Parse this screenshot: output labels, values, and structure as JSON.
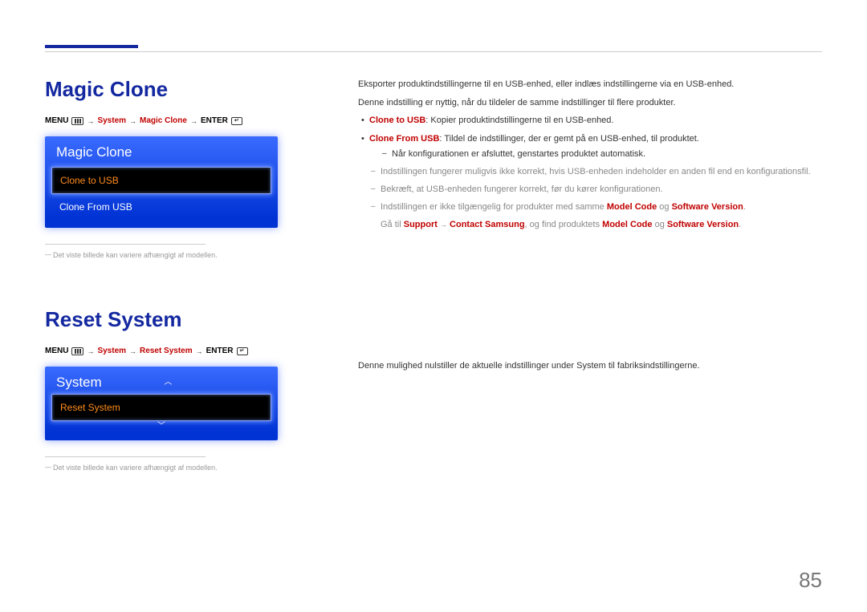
{
  "page_number": "85",
  "section1": {
    "title": "Magic Clone",
    "breadcrumb": {
      "menu": "MENU",
      "system": "System",
      "item": "Magic Clone",
      "enter": "ENTER"
    },
    "osd": {
      "title": "Magic Clone",
      "items": [
        {
          "label": "Clone to USB",
          "selected": true
        },
        {
          "label": "Clone From USB",
          "selected": false
        }
      ]
    },
    "disclaimer": "Det viste billede kan variere afhængigt af modellen.",
    "body": {
      "p1": "Eksporter produktindstillingerne til en USB-enhed, eller indlæs indstillingerne via en USB-enhed.",
      "p2": "Denne indstilling er nyttig, når du tildeler de samme indstillinger til flere produkter.",
      "li1_label": "Clone to USB",
      "li1_text": ": Kopier produktindstillingerne til en USB-enhed.",
      "li2_label": "Clone From USB",
      "li2_text": ": Tildel de indstillinger, der er gemt på en USB-enhed, til produktet.",
      "sub1": "Når konfigurationen er afsluttet, genstartes produktet automatisk.",
      "sub2": "Indstillingen fungerer muligvis ikke korrekt, hvis USB-enheden indeholder en anden fil end en konfigurationsfil.",
      "sub3": "Bekræft, at USB-enheden fungerer korrekt, før du kører konfigurationen.",
      "sub4_a": "Indstillingen er ikke tilgængelig for produkter med samme ",
      "sub4_mc": "Model Code",
      "sub4_b": " og ",
      "sub4_sv": "Software Version",
      "sub4_c": ".",
      "sub5_a": "Gå til ",
      "sub5_support": "Support",
      "sub5_b": " ",
      "sub5_contact": "Contact Samsung",
      "sub5_c": ", og find produktets ",
      "sub5_mc": "Model Code",
      "sub5_d": " og ",
      "sub5_sv": "Software Version",
      "sub5_e": "."
    }
  },
  "section2": {
    "title": "Reset System",
    "breadcrumb": {
      "menu": "MENU",
      "system": "System",
      "item": "Reset System",
      "enter": "ENTER"
    },
    "osd": {
      "title": "System",
      "items": [
        {
          "label": "Reset System",
          "selected": true
        }
      ]
    },
    "disclaimer": "Det viste billede kan variere afhængigt af modellen.",
    "body": {
      "p1": "Denne mulighed nulstiller de aktuelle indstillinger under System til fabriksindstillingerne."
    }
  }
}
